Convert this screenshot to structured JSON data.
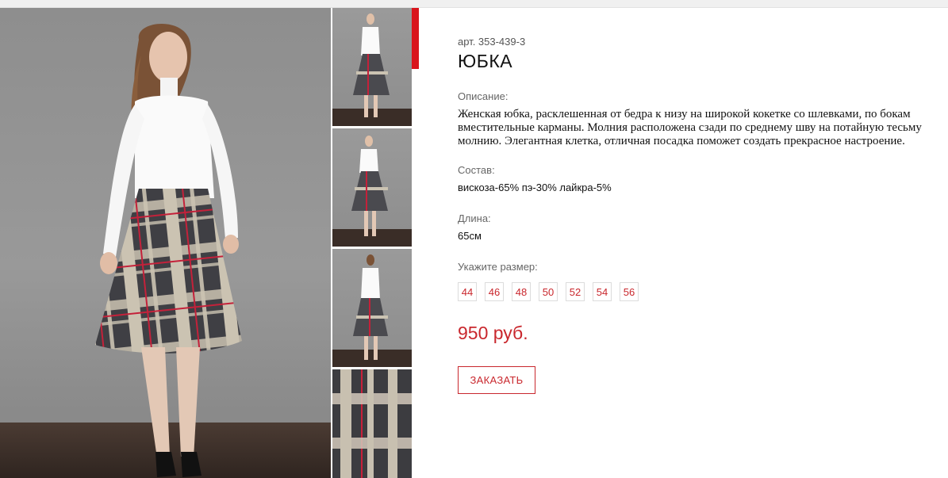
{
  "product": {
    "sku": "арт. 353-439-3",
    "title": "ЮБКА",
    "description_label": "Описание:",
    "description": "Женская юбка, расклешенная от бедра к низу на широкой кокетке со шлевками, по бокам вместительные карманы. Молния расположена сзади по среднему шву на потайную тесьму молнию. Элегантная клетка, отличная посадка поможет создать прекрасное настроение.",
    "composition_label": "Состав:",
    "composition": "вискоза-65% пэ-30% лайкра-5%",
    "length_label": "Длина:",
    "length": "65см",
    "size_label": "Укажите размер:",
    "sizes": [
      "44",
      "46",
      "48",
      "50",
      "52",
      "54",
      "56"
    ],
    "price": "950 руб.",
    "order_button": "ЗАКАЗАТЬ"
  },
  "colors": {
    "accent": "#c9272d",
    "active_marker": "#d9151c"
  }
}
